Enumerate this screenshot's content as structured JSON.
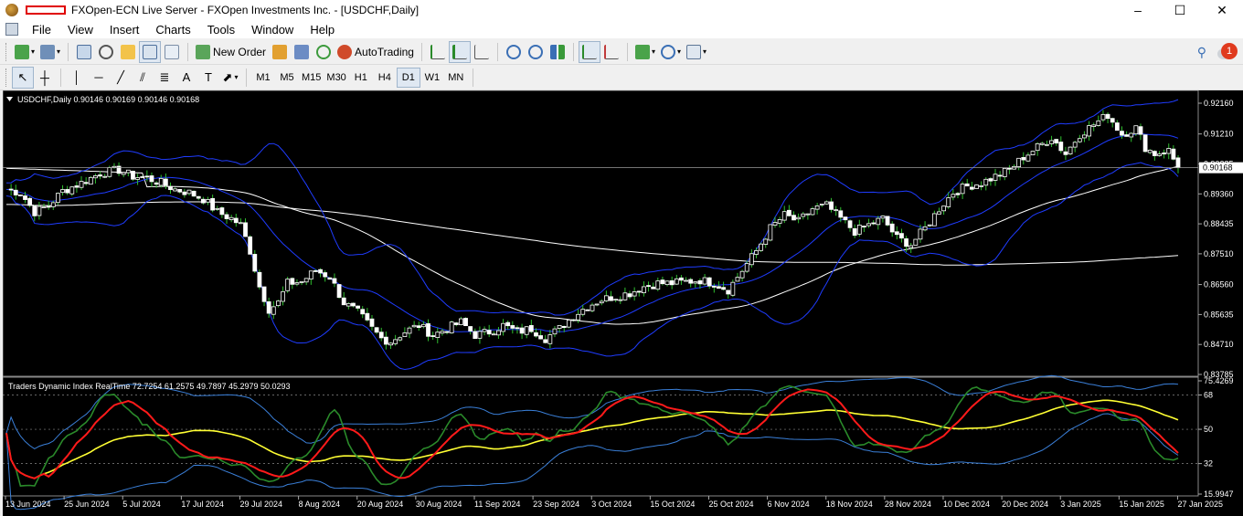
{
  "window": {
    "title": "FXOpen-ECN Live Server - FXOpen Investments Inc. - [USDCHF,Daily]",
    "minimize": "–",
    "maximize": "☐",
    "close": "✕"
  },
  "menu": {
    "items": [
      "File",
      "View",
      "Insert",
      "Charts",
      "Tools",
      "Window",
      "Help"
    ],
    "mdi": [
      "_",
      "▫",
      "✕"
    ]
  },
  "toolbar": {
    "new_order_label": "New Order",
    "autotrading_label": "AutoTrading",
    "timeframes": [
      "M1",
      "M5",
      "M15",
      "M30",
      "H1",
      "H4",
      "D1",
      "W1",
      "MN"
    ],
    "active_timeframe": "D1",
    "notification_count": "1"
  },
  "colors": {
    "bull": "#ffffff",
    "bear": "#ffffff",
    "bb": "#1f3cff",
    "ma": "#ffffff",
    "tdi_green": "#2a8a2a",
    "tdi_red": "#ff1a1a",
    "tdi_yellow": "#ffff33",
    "tdi_band": "#3a7fd8"
  },
  "chart_data": {
    "type": "candlestick",
    "symbol_info": "USDCHF,Daily  0.90146 0.90169 0.90146 0.90168",
    "current_price": "0.90168",
    "price_ticks": [
      "0.92160",
      "0.91210",
      "0.90285",
      "0.89360",
      "0.88435",
      "0.87510",
      "0.86560",
      "0.85635",
      "0.84710",
      "0.83785"
    ],
    "price_tick_values": [
      0.9216,
      0.9121,
      0.90285,
      0.8936,
      0.88435,
      0.8751,
      0.8656,
      0.85635,
      0.8471,
      0.83785
    ],
    "price_range": [
      0.83785,
      0.9216
    ],
    "date_ticks": [
      "13 Jun 2024",
      "25 Jun 2024",
      "5 Jul 2024",
      "17 Jul 2024",
      "29 Jul 2024",
      "8 Aug 2024",
      "20 Aug 2024",
      "30 Aug 2024",
      "11 Sep 2024",
      "23 Sep 2024",
      "3 Oct 2024",
      "15 Oct 2024",
      "25 Oct 2024",
      "6 Nov 2024",
      "18 Nov 2024",
      "28 Nov 2024",
      "10 Dec 2024",
      "20 Dec 2024",
      "3 Jan 2025",
      "15 Jan 2025",
      "27 Jan 2025"
    ],
    "close_path": [
      [
        0,
        0.895
      ],
      [
        3,
        0.894
      ],
      [
        6,
        0.888
      ],
      [
        9,
        0.89
      ],
      [
        12,
        0.8945
      ],
      [
        16,
        0.897
      ],
      [
        20,
        0.9
      ],
      [
        24,
        0.901
      ],
      [
        27,
        0.899
      ],
      [
        30,
        0.8985
      ],
      [
        33,
        0.897
      ],
      [
        36,
        0.895
      ],
      [
        39,
        0.894
      ],
      [
        42,
        0.892
      ],
      [
        45,
        0.888
      ],
      [
        48,
        0.886
      ],
      [
        50,
        0.884
      ],
      [
        52,
        0.876
      ],
      [
        54,
        0.865
      ],
      [
        56,
        0.858
      ],
      [
        58,
        0.86
      ],
      [
        60,
        0.866
      ],
      [
        63,
        0.8665
      ],
      [
        66,
        0.87
      ],
      [
        69,
        0.868
      ],
      [
        72,
        0.86
      ],
      [
        75,
        0.857
      ],
      [
        78,
        0.852
      ],
      [
        80,
        0.849
      ],
      [
        82,
        0.848
      ],
      [
        85,
        0.851
      ],
      [
        88,
        0.853
      ],
      [
        91,
        0.85
      ],
      [
        94,
        0.852
      ],
      [
        97,
        0.854
      ],
      [
        100,
        0.85
      ],
      [
        103,
        0.851
      ],
      [
        106,
        0.853
      ],
      [
        109,
        0.851
      ],
      [
        112,
        0.852
      ],
      [
        115,
        0.849
      ],
      [
        118,
        0.852
      ],
      [
        121,
        0.856
      ],
      [
        124,
        0.859
      ],
      [
        127,
        0.861
      ],
      [
        130,
        0.862
      ],
      [
        133,
        0.863
      ],
      [
        136,
        0.865
      ],
      [
        139,
        0.866
      ],
      [
        142,
        0.866
      ],
      [
        145,
        0.8665
      ],
      [
        148,
        0.867
      ],
      [
        151,
        0.866
      ],
      [
        154,
        0.864
      ],
      [
        157,
        0.87
      ],
      [
        160,
        0.876
      ],
      [
        163,
        0.883
      ],
      [
        166,
        0.887
      ],
      [
        169,
        0.885
      ],
      [
        172,
        0.889
      ],
      [
        175,
        0.89
      ],
      [
        178,
        0.886
      ],
      [
        181,
        0.882
      ],
      [
        184,
        0.884
      ],
      [
        187,
        0.886
      ],
      [
        190,
        0.88
      ],
      [
        193,
        0.878
      ],
      [
        196,
        0.883
      ],
      [
        199,
        0.889
      ],
      [
        202,
        0.894
      ],
      [
        205,
        0.896
      ],
      [
        208,
        0.897
      ],
      [
        211,
        0.899
      ],
      [
        214,
        0.901
      ],
      [
        217,
        0.905
      ],
      [
        220,
        0.908
      ],
      [
        223,
        0.911
      ],
      [
        226,
        0.906
      ],
      [
        229,
        0.912
      ],
      [
        232,
        0.915
      ],
      [
        235,
        0.918
      ],
      [
        238,
        0.912
      ],
      [
        241,
        0.914
      ],
      [
        243,
        0.908
      ],
      [
        245,
        0.906
      ],
      [
        248,
        0.907
      ],
      [
        250,
        0.9017
      ]
    ],
    "tdi_info": "Traders Dynamic Index RealTime 72.7254 61.2575 49.7897 45.2979 50.0293",
    "tdi_ticks": [
      "75.4269",
      "68",
      "50",
      "32",
      "15.9947"
    ],
    "tdi_tick_values": [
      75.4269,
      68,
      50,
      32,
      15.9947
    ],
    "tdi_range": [
      15.9947,
      75.4269
    ],
    "tdi_levels": [
      68,
      50,
      32
    ],
    "tdi_values": {
      "band_upper": 72.7254,
      "band_mid": 61.2575,
      "band_lower": 49.7897,
      "signal": 45.2979,
      "price_line": 50.0293
    }
  }
}
